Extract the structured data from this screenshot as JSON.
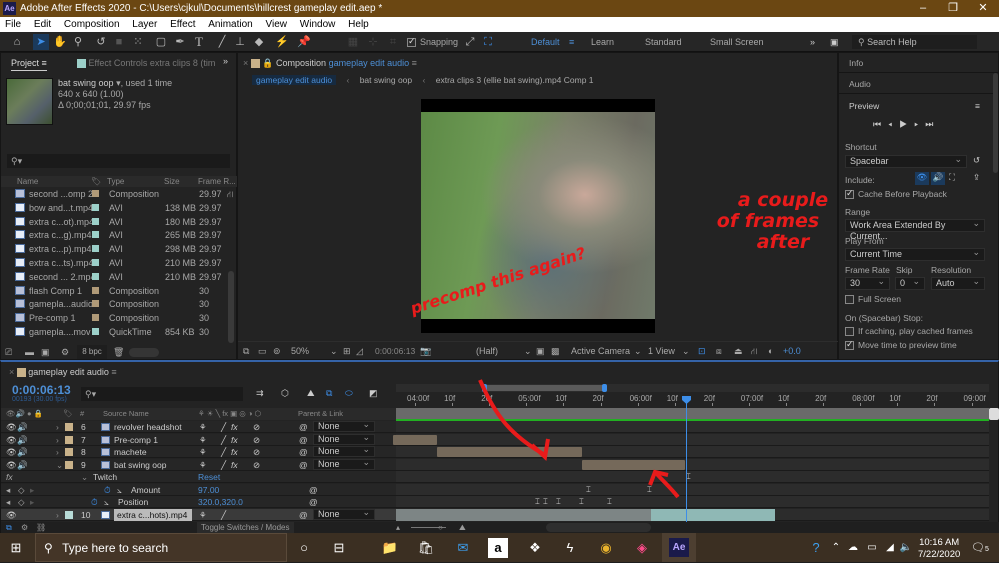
{
  "window": {
    "app_icon": "Ae",
    "title": "Adobe After Effects 2020 - C:\\Users\\cjkul\\Documents\\hillcrest gameplay edit.aep *",
    "controls": [
      "minimize",
      "restore",
      "close"
    ]
  },
  "menubar": [
    "File",
    "Edit",
    "Composition",
    "Layer",
    "Effect",
    "Animation",
    "View",
    "Window",
    "Help"
  ],
  "toolbar": {
    "tools": [
      "home-icon",
      "selection-tool-icon",
      "hand-tool-icon",
      "zoom-tool-icon",
      "rotation-tool-icon",
      "camera-tool-icon",
      "pan-behind-tool-icon",
      "rectangle-tool-icon",
      "pen-tool-icon",
      "type-tool-icon",
      "brush-tool-icon",
      "clone-stamp-tool-icon",
      "eraser-tool-icon",
      "roto-brush-tool-icon",
      "puppet-pin-tool-icon"
    ],
    "snapping_label": "Snapping",
    "snapping_checked": true,
    "workspaces": [
      "Default",
      "Learn",
      "Standard",
      "Small Screen"
    ],
    "active_workspace": "Default",
    "search_help_placeholder": "Search Help"
  },
  "project_panel": {
    "tab_label": "Project",
    "effect_controls_label": "Effect Controls",
    "effect_controls_target": "extra clips 8 (tim",
    "selected_item": {
      "name": "bat swing oop",
      "usage": ", used 1 time",
      "dimensions": "640 x 640 (1.00)",
      "duration": "Δ 0;00;01;01, 29.97 fps"
    },
    "search_placeholder": "",
    "columns": [
      "Name",
      "Type",
      "Size",
      "Frame R..."
    ],
    "items": [
      {
        "name": "second ...omp 2",
        "type": "Composition",
        "size": "",
        "fps": "29.97",
        "kind": "comp"
      },
      {
        "name": "bow and...t.mp4",
        "type": "AVI",
        "size": "138 MB",
        "fps": "29.97",
        "kind": "footage"
      },
      {
        "name": "extra c...ot).mp4",
        "type": "AVI",
        "size": "180 MB",
        "fps": "29.97",
        "kind": "footage"
      },
      {
        "name": "extra c...g).mp4",
        "type": "AVI",
        "size": "265 MB",
        "fps": "29.97",
        "kind": "footage"
      },
      {
        "name": "extra c...p).mp4",
        "type": "AVI",
        "size": "298 MB",
        "fps": "29.97",
        "kind": "footage"
      },
      {
        "name": "extra c...ts).mp4",
        "type": "AVI",
        "size": "210 MB",
        "fps": "29.97",
        "kind": "footage"
      },
      {
        "name": "second ... 2.mp4",
        "type": "AVI",
        "size": "210 MB",
        "fps": "29.97",
        "kind": "footage"
      },
      {
        "name": "flash Comp 1",
        "type": "Composition",
        "size": "",
        "fps": "30",
        "kind": "comp"
      },
      {
        "name": "gamepla...audio",
        "type": "Composition",
        "size": "",
        "fps": "30",
        "kind": "comp"
      },
      {
        "name": "Pre-comp 1",
        "type": "Composition",
        "size": "",
        "fps": "30",
        "kind": "comp"
      },
      {
        "name": "gamepla....mov",
        "type": "QuickTime",
        "size": "854 KB",
        "fps": "30",
        "kind": "footage"
      }
    ],
    "bit_depth": "8 bpc"
  },
  "composition_panel": {
    "tab_prefix": "Composition",
    "tab_comp": "gameplay edit audio",
    "breadcrumbs": [
      "gameplay edit audio",
      "bat swing oop",
      "extra clips 3 (ellie bat swing).mp4 Comp 1"
    ],
    "zoom": "50%",
    "timecode": "0:00:06:13",
    "resolution": "(Half)",
    "camera": "Active Camera",
    "views": "1 View",
    "exposure": "+0.0"
  },
  "right_panel": {
    "info_label": "Info",
    "audio_label": "Audio",
    "preview_label": "Preview",
    "shortcut_label": "Shortcut",
    "shortcut_value": "Spacebar",
    "include_label": "Include:",
    "cache_before_playback": "Cache Before Playback",
    "cache_checked": true,
    "range_label": "Range",
    "range_value": "Work Area Extended By Current...",
    "play_from_label": "Play From",
    "play_from_value": "Current Time",
    "frame_rate_label": "Frame Rate",
    "frame_rate_value": "30",
    "skip_label": "Skip",
    "skip_value": "0",
    "resolution_label": "Resolution",
    "resolution_value": "Auto",
    "full_screen": "Full Screen",
    "full_screen_checked": false,
    "stop_label": "On (Spacebar) Stop:",
    "if_caching": "If caching, play cached frames",
    "if_caching_checked": false,
    "move_time": "Move time to preview time",
    "move_time_checked": true
  },
  "timeline": {
    "tab_label": "gameplay edit audio",
    "current_time": "0:00:06:13",
    "frame_info": "00193 (30.00 fps)",
    "columns": {
      "source_name": "Source Name",
      "parent": "Parent & Link"
    },
    "ruler": [
      "04:00f",
      "10f",
      "20f",
      "05:00f",
      "10f",
      "20f",
      "06:00f",
      "10f",
      "20f",
      "07:00f",
      "10f",
      "20f",
      "08:00f",
      "10f",
      "20f",
      "09:00f"
    ],
    "layers": [
      {
        "num": "6",
        "name": "revolver headshot",
        "parent": "None"
      },
      {
        "num": "7",
        "name": "Pre-comp 1",
        "parent": "None"
      },
      {
        "num": "8",
        "name": "machete",
        "parent": "None"
      },
      {
        "num": "9",
        "name": "bat swing oop",
        "parent": "None",
        "expanded": true
      }
    ],
    "effect": {
      "name": "Twitch",
      "reset": "Reset"
    },
    "properties": [
      {
        "name": "Amount",
        "value": "97.00"
      },
      {
        "name": "Position",
        "value": "320.0,320.0"
      }
    ],
    "selected_layer": {
      "num": "10",
      "name": "extra c...hots).mp4",
      "parent": "None"
    },
    "toggle_label": "Toggle Switches / Modes"
  },
  "annotations": {
    "note1": "precomp this again?",
    "note2_line1": "a couple",
    "note2_line2": "of frames",
    "note2_line3": "after"
  },
  "taskbar": {
    "search_placeholder": "Type here to search",
    "time": "10:16 AM",
    "date": "7/22/2020",
    "notifications": "5"
  }
}
